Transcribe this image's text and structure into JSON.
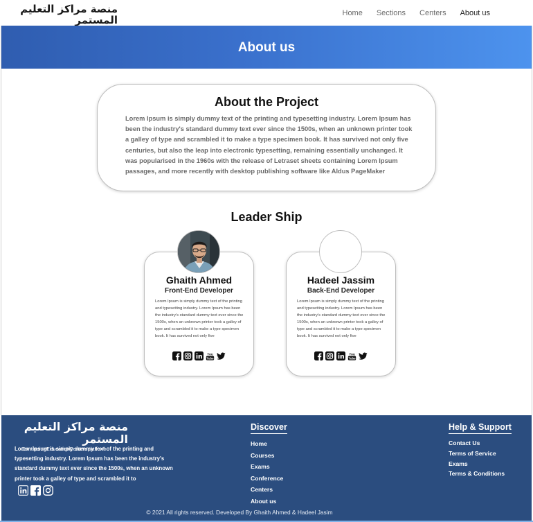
{
  "brand": {
    "arabic": "منصة مراكز التعليم المستمر",
    "english": "ContinuingEducationCentersplatform"
  },
  "nav": {
    "items": [
      {
        "label": "Home",
        "active": false
      },
      {
        "label": "Sections",
        "active": false
      },
      {
        "label": "Centers",
        "active": false
      },
      {
        "label": "About us",
        "active": true
      }
    ]
  },
  "hero": {
    "title": "About us"
  },
  "project": {
    "title": "About the Project",
    "text": "Lorem Ipsum is simply dummy text of the printing and typesetting industry. Lorem Ipsum has been the industry's standard dummy text ever since the 1500s, when an unknown printer took a galley of type and scrambled it to make a type specimen book. It has survived not only five centuries, but also the leap into electronic typesetting, remaining essentially unchanged. It was popularised in the 1960s with the release of Letraset sheets containing Lorem Ipsum passages, and more recently with desktop publishing software like Aldus PageMaker"
  },
  "leadership": {
    "title": "Leader Ship",
    "members": [
      {
        "name": "Ghaith Ahmed",
        "role": "Front-End Developer",
        "bio": "Lorem Ipsum is simply dummy text of the printing and typesetting industry. Lorem Ipsum has been the industry's standard dummy text ever since the 1500s, when an unknown printer took a galley of type and scrambled it to make a type specimen book. It has survived not only five"
      },
      {
        "name": "Hadeel Jassim",
        "role": "Back-End Developer",
        "bio": "Lorem Ipsum is simply dummy text of the printing and typesetting industry. Lorem Ipsum has been the industry's standard dummy text ever since the 1500s, when an unknown printer took a galley of type and scrambled it to make a type specimen book. It has survived not only five"
      }
    ],
    "social_icons": [
      "facebook-icon",
      "instagram-icon",
      "linkedin-icon",
      "youtube-icon",
      "twitter-icon"
    ]
  },
  "footer": {
    "description": "Lorem Ipsum is simply dummy text of the printing and typesetting industry. Lorem Ipsum has been the industry's standard dummy text ever since the 1500s, when an unknown printer took a galley of type and scrambled it to",
    "social_icons": [
      "linkedin-icon",
      "facebook-icon",
      "instagram-icon"
    ],
    "discover": {
      "title": "Discover",
      "links": [
        "Home",
        "Courses",
        "Exams",
        "Conference",
        "Centers",
        "About us"
      ]
    },
    "help": {
      "title": "Help & Support",
      "links": [
        "Contact Us",
        "Terms of Service",
        "Exams",
        "Terms & Conditions"
      ]
    },
    "copyright": "© 2021 All rights reserved. Developed By Ghaith Ahmed & Hadeel Jasim"
  },
  "colors": {
    "hero_start": "#2f5db0",
    "hero_end": "#4d93ee",
    "footer_bg": "#2b4d7f"
  }
}
